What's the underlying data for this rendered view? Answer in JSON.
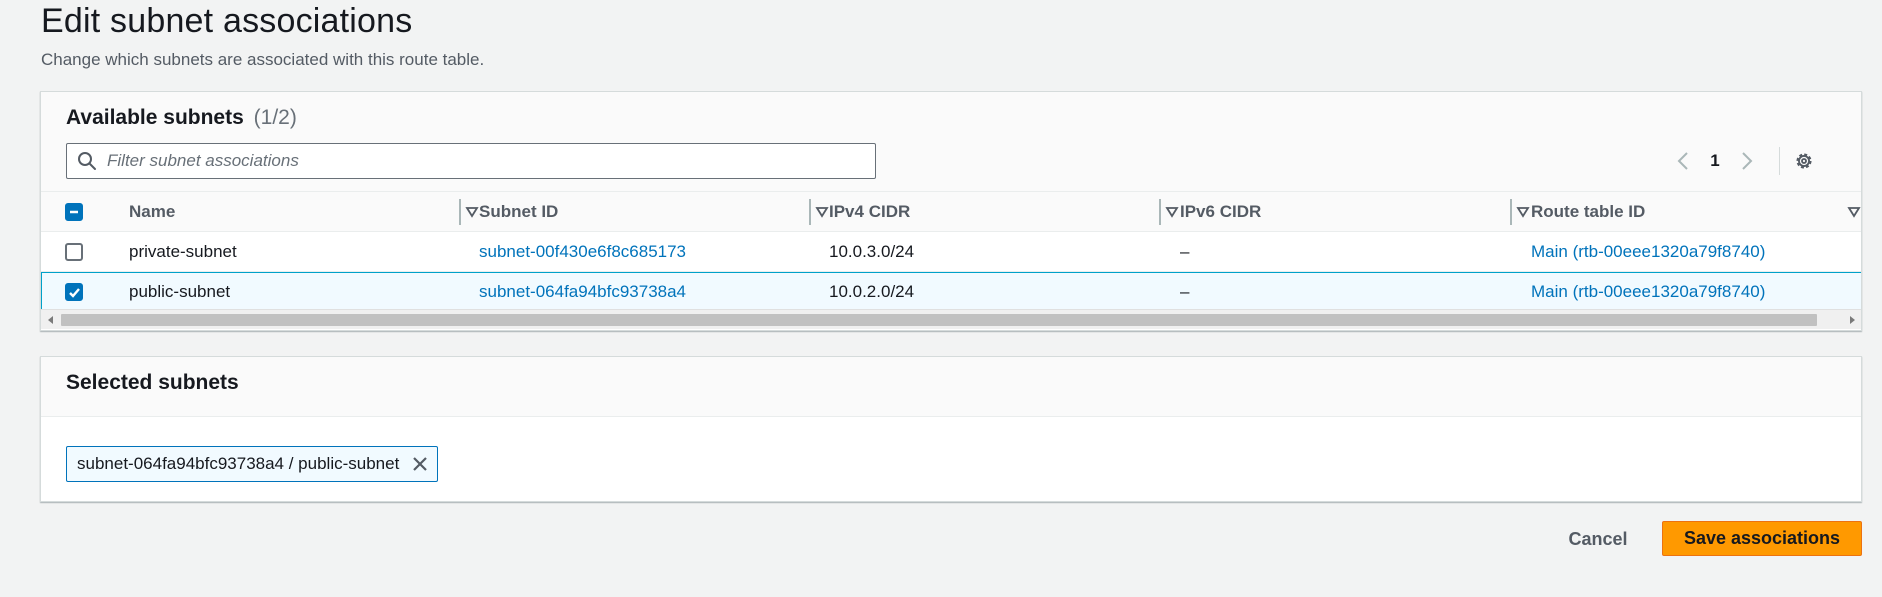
{
  "page": {
    "title": "Edit subnet associations",
    "description": "Change which subnets are associated with this route table."
  },
  "available": {
    "title": "Available subnets",
    "count": "(1/2)",
    "filter_placeholder": "Filter subnet associations",
    "filter_value": "",
    "page_number": "1",
    "columns": [
      "Name",
      "Subnet ID",
      "IPv4 CIDR",
      "IPv6 CIDR",
      "Route table ID"
    ],
    "rows": [
      {
        "checked": false,
        "name": "private-subnet",
        "subnet_id": "subnet-00f430e6f8c685173",
        "ipv4": "10.0.3.0/24",
        "ipv6": "–",
        "route_table": "Main (rtb-00eee1320a79f8740)"
      },
      {
        "checked": true,
        "name": "public-subnet",
        "subnet_id": "subnet-064fa94bfc93738a4",
        "ipv4": "10.0.2.0/24",
        "ipv6": "–",
        "route_table": "Main (rtb-00eee1320a79f8740)"
      }
    ]
  },
  "selected": {
    "title": "Selected subnets",
    "tokens": [
      "subnet-064fa94bfc93738a4 / public-subnet"
    ]
  },
  "actions": {
    "cancel_label": "Cancel",
    "save_label": "Save associations"
  },
  "colors": {
    "accent": "#0073bb",
    "primary_button": "#ff9900",
    "page_background": "#f2f3f3"
  },
  "icons": [
    "search-icon",
    "chevron-left-icon",
    "chevron-right-icon",
    "settings-gear-icon",
    "sort-caret-icon",
    "close-icon",
    "checkmark-icon"
  ]
}
